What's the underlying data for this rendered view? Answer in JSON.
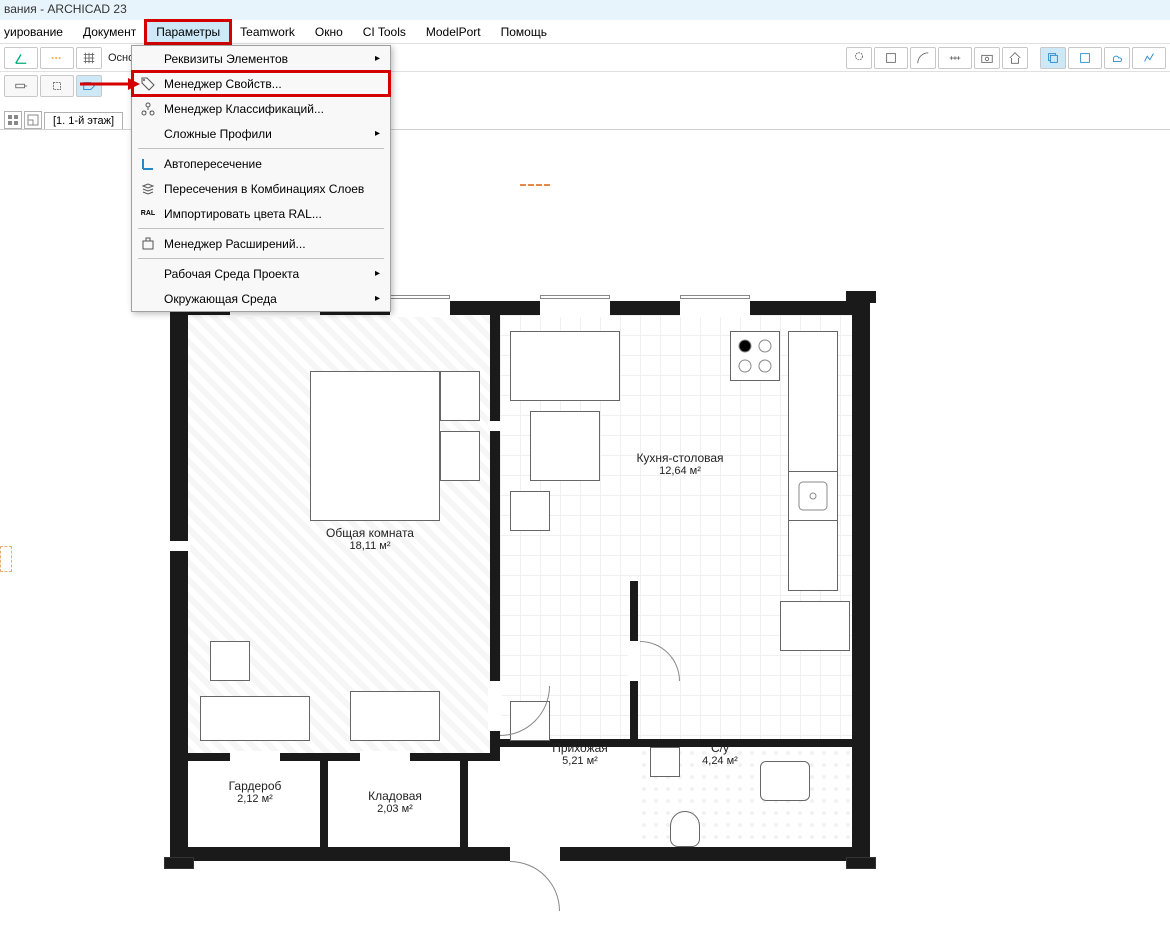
{
  "title": "вания - ARCHICAD 23",
  "menubar": {
    "items": [
      "уирование",
      "Документ",
      "Параметры",
      "Teamwork",
      "Окно",
      "CI Tools",
      "ModelPort",
      "Помощь"
    ],
    "active_index": 2
  },
  "toolbar_label": "Основная:",
  "dropdown": {
    "items": [
      {
        "label": "Реквизиты Элементов",
        "submenu": true
      },
      {
        "label": "Менеджер Свойств...",
        "icon": "tag-icon",
        "highlighted": true
      },
      {
        "label": "Менеджер Классификаций...",
        "icon": "tree-icon"
      },
      {
        "label": "Сложные Профили",
        "submenu": true
      },
      {
        "sep": true
      },
      {
        "label": "Автопересечение",
        "icon": "intersect-icon"
      },
      {
        "label": "Пересечения в Комбинациях Слоев",
        "icon": "layers-icon"
      },
      {
        "label": "Импортировать цвета RAL...",
        "icon": "ral-icon",
        "icon_text": "RAL"
      },
      {
        "sep": true
      },
      {
        "label": "Менеджер Расширений...",
        "icon": "plugin-icon"
      },
      {
        "sep": true
      },
      {
        "label": "Рабочая Среда Проекта",
        "submenu": true
      },
      {
        "label": "Окружающая Среда",
        "submenu": true
      }
    ]
  },
  "tab": {
    "label": "[1. 1-й этаж]"
  },
  "rooms": {
    "living": {
      "name": "Общая комната",
      "area": "18,11 м²"
    },
    "kitchen": {
      "name": "Кухня-столовая",
      "area": "12,64 м²"
    },
    "hall": {
      "name": "Прихожая",
      "area": "5,21 м²"
    },
    "bath": {
      "name": "С/у",
      "area": "4,24 м²"
    },
    "wardrobe": {
      "name": "Гардероб",
      "area": "2,12 м²"
    },
    "storage": {
      "name": "Кладовая",
      "area": "2,03 м²"
    }
  }
}
